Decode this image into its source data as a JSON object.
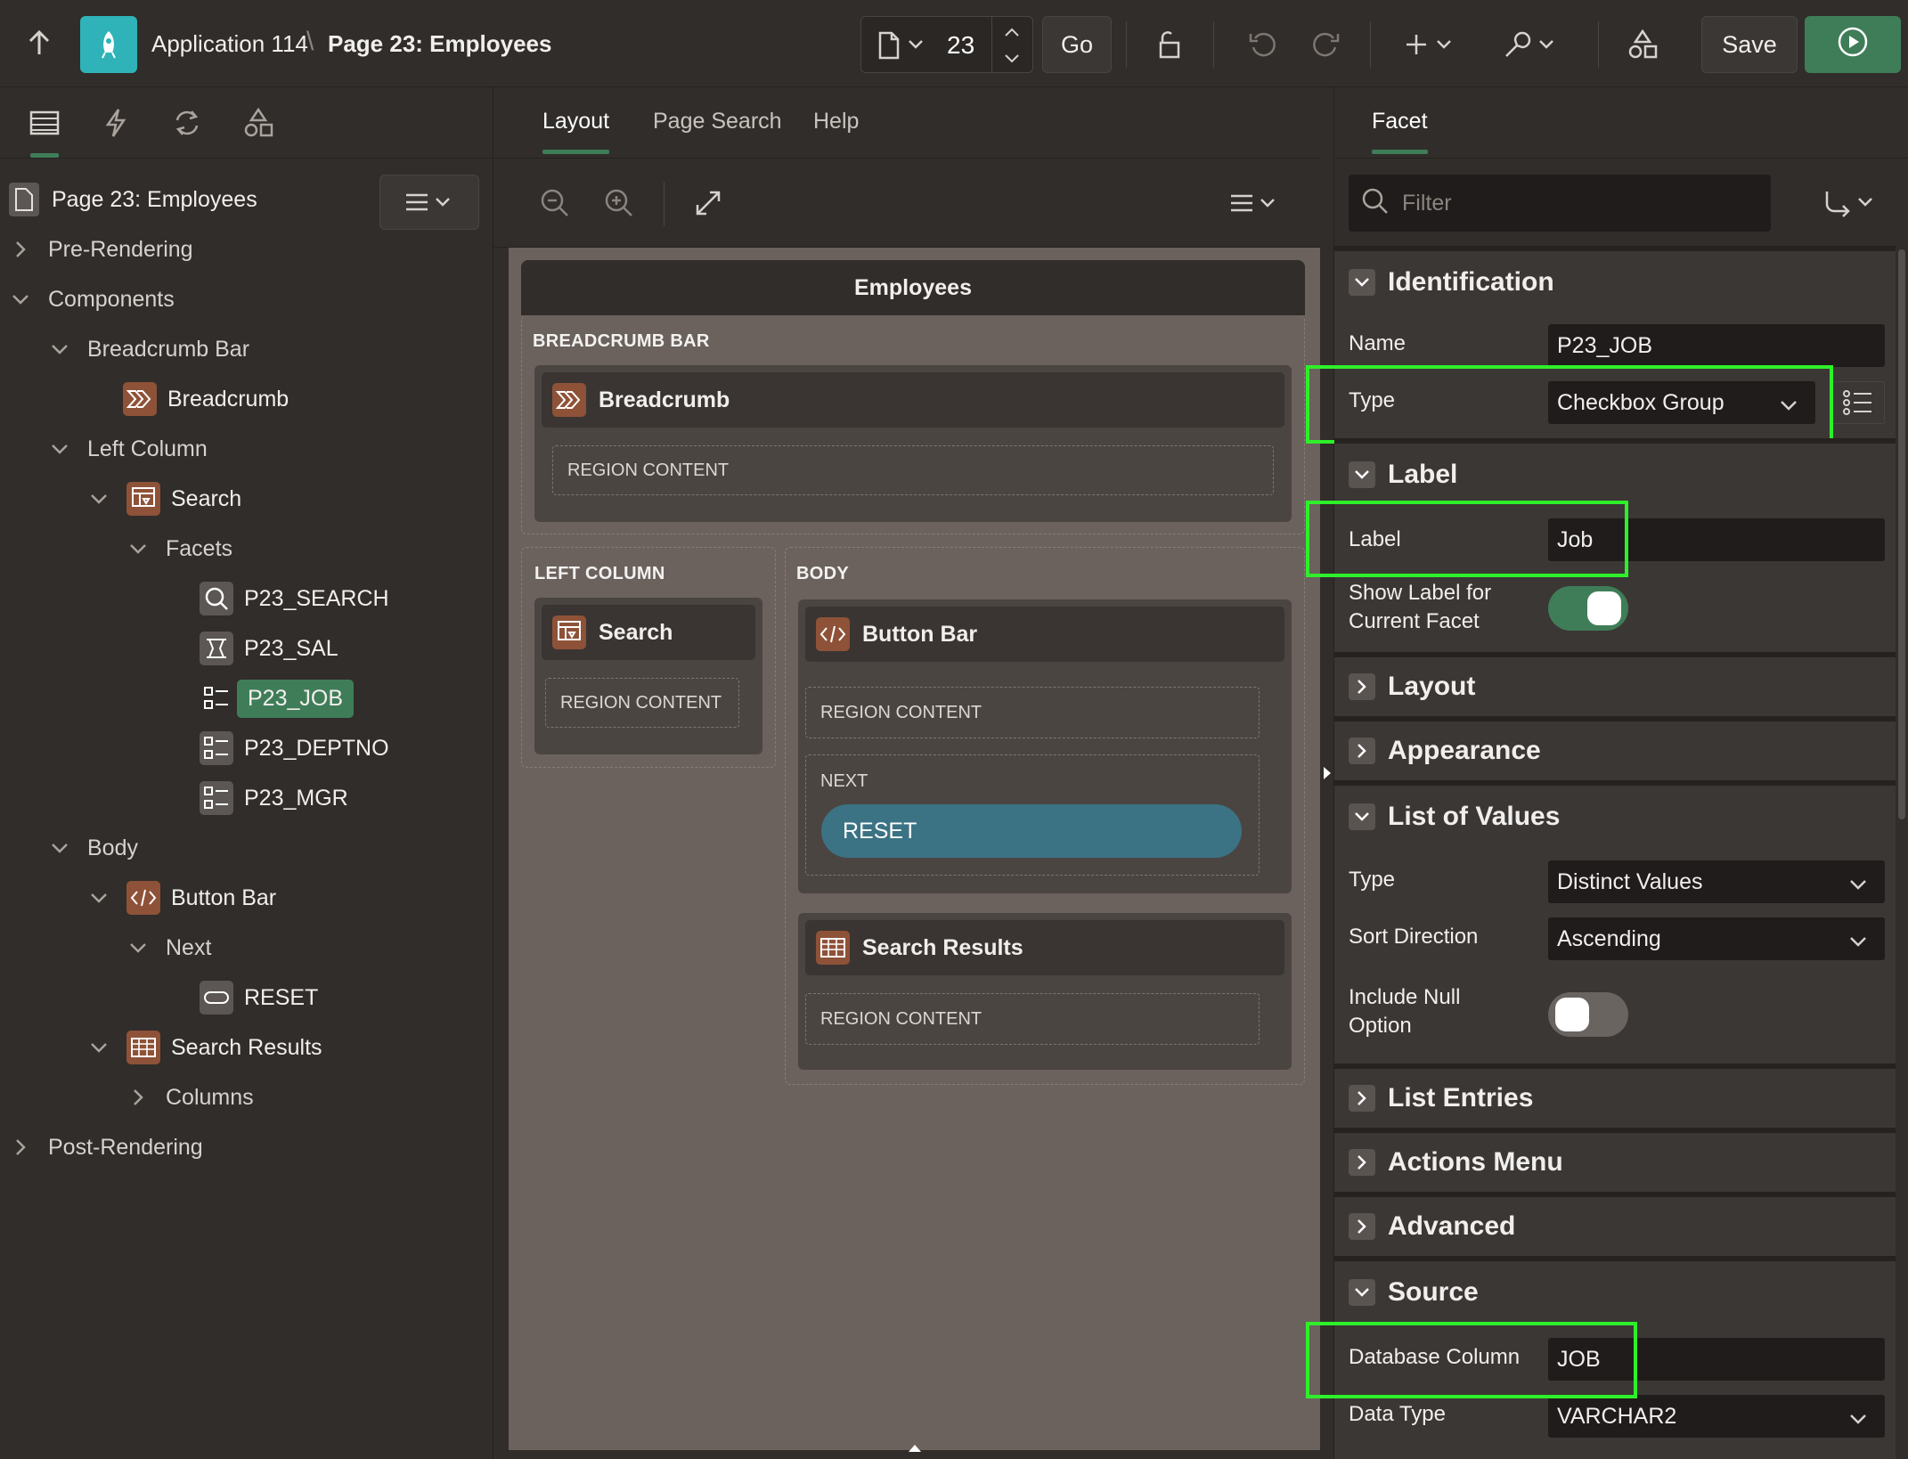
{
  "header": {
    "breadcrumb_app": "Application 114",
    "breadcrumb_sep": "\\",
    "breadcrumb_page": "Page 23: Employees",
    "page_number": "23",
    "go_label": "Go",
    "save_label": "Save"
  },
  "tree": {
    "page_title": "Page 23: Employees",
    "rows": [
      {
        "label": "Pre-Rendering"
      },
      {
        "label": "Components"
      },
      {
        "label": "Breadcrumb Bar"
      },
      {
        "label": "Breadcrumb"
      },
      {
        "label": "Left Column"
      },
      {
        "label": "Search"
      },
      {
        "label": "Facets"
      },
      {
        "label": "P23_SEARCH"
      },
      {
        "label": "P23_SAL"
      },
      {
        "label": "P23_JOB"
      },
      {
        "label": "P23_DEPTNO"
      },
      {
        "label": "P23_MGR"
      },
      {
        "label": "Body"
      },
      {
        "label": "Button Bar"
      },
      {
        "label": "Next"
      },
      {
        "label": "RESET"
      },
      {
        "label": "Search Results"
      },
      {
        "label": "Columns"
      },
      {
        "label": "Post-Rendering"
      }
    ]
  },
  "center": {
    "tabs": [
      "Layout",
      "Page Search",
      "Help"
    ],
    "page_title": "Employees",
    "breadcrumb_bar": "BREADCRUMB BAR",
    "breadcrumb_region": "Breadcrumb",
    "left_column": "LEFT COLUMN",
    "search_region": "Search",
    "body": "BODY",
    "button_bar_region": "Button Bar",
    "next_slot": "NEXT",
    "reset_button": "RESET",
    "search_results_region": "Search Results",
    "region_content": "REGION CONTENT"
  },
  "right": {
    "tab": "Facet",
    "filter_placeholder": "Filter",
    "sections": {
      "identification": "Identification",
      "label": "Label",
      "layout": "Layout",
      "appearance": "Appearance",
      "lov": "List of Values",
      "list_entries": "List Entries",
      "actions_menu": "Actions Menu",
      "advanced": "Advanced",
      "source": "Source"
    },
    "props": {
      "name_lbl": "Name",
      "name_val": "P23_JOB",
      "type_lbl": "Type",
      "type_val": "Checkbox Group",
      "label_lbl": "Label",
      "label_val": "Job",
      "show_label_lbl1": "Show Label for",
      "show_label_lbl2": "Current Facet",
      "lov_type_lbl": "Type",
      "lov_type_val": "Distinct Values",
      "sort_lbl": "Sort Direction",
      "sort_val": "Ascending",
      "null_lbl1": "Include Null",
      "null_lbl2": "Option",
      "db_col_lbl": "Database Column",
      "db_col_val": "JOB",
      "data_type_lbl": "Data Type",
      "data_type_val": "VARCHAR2"
    },
    "show_label_on": true,
    "include_null_on": false,
    "highlight_color": "#2ef02a"
  },
  "colors": {
    "accent": "#3f7d58",
    "orange_icon": "#8e5238",
    "teal_app": "#2fb3b8",
    "reset_button": "#3b7384"
  }
}
